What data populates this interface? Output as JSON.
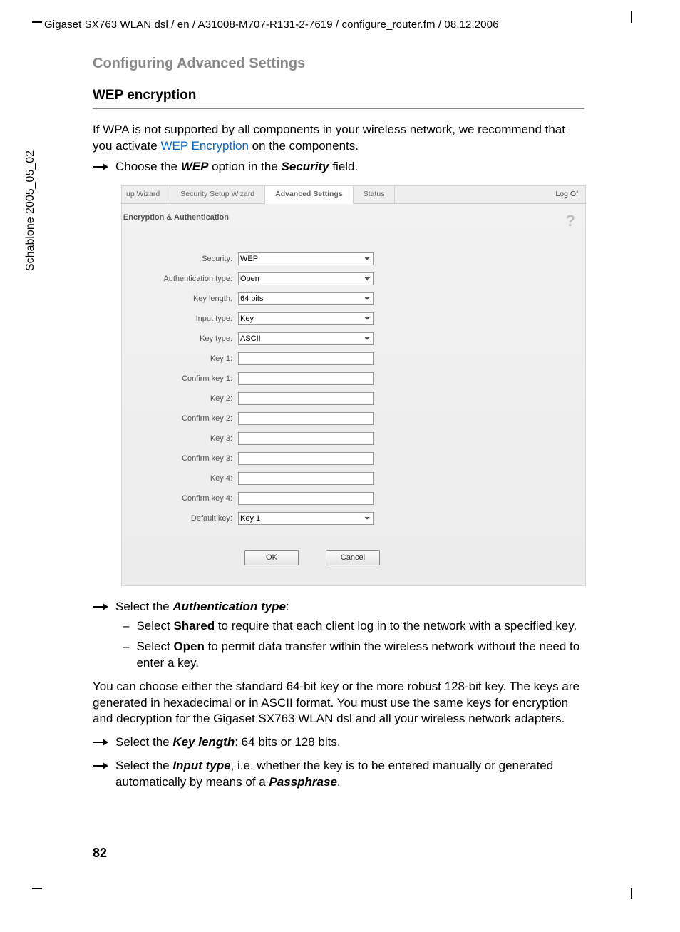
{
  "header_path": "Gigaset SX763 WLAN dsl / en / A31008-M707-R131-2-7619 / configure_router.fm / 08.12.2006",
  "side_label": "Schablone 2005_05_02",
  "breadcrumb": "Configuring Advanced Settings",
  "section_title": "WEP encryption",
  "intro_pre": "If WPA is not supported by all components in your wireless network, we recommend that you activate ",
  "intro_link": "WEP Encryption",
  "intro_post": " on the components.",
  "step1_pre": "Choose the ",
  "step1_b1": "WEP",
  "step1_mid": " option in the ",
  "step1_b2": "Security",
  "step1_post": " field.",
  "shot": {
    "tabs": {
      "t0": "up Wizard",
      "t1": "Security Setup Wizard",
      "t2": "Advanced Settings",
      "t3": "Status"
    },
    "logoff": "Log Of",
    "panel_title": "Encryption & Authentication",
    "help": "?",
    "labels": {
      "security": "Security:",
      "auth": "Authentication type:",
      "keylen": "Key length:",
      "inputtype": "Input type:",
      "keytype": "Key type:",
      "k1": "Key 1:",
      "ck1": "Confirm key 1:",
      "k2": "Key 2:",
      "ck2": "Confirm key 2:",
      "k3": "Key 3:",
      "ck3": "Confirm key 3:",
      "k4": "Key 4:",
      "ck4": "Confirm key 4:",
      "defkey": "Default key:"
    },
    "values": {
      "security": "WEP",
      "auth": "Open",
      "keylen": "64 bits",
      "inputtype": "Key",
      "keytype": "ASCII",
      "defkey": "Key 1"
    },
    "buttons": {
      "ok": "OK",
      "cancel": "Cancel"
    }
  },
  "step2_pre": "Select the ",
  "step2_b": "Authentication type",
  "step2_post": ":",
  "dash1_pre": "Select ",
  "dash1_b": "Shared",
  "dash1_post": " to require that each client log in to the network with a specified key.",
  "dash2_pre": "Select ",
  "dash2_b": "Open",
  "dash2_post": " to permit data transfer within the wireless network without the need to enter a key.",
  "para2": "You can choose either the standard 64-bit key or the more robust 128-bit key. The keys are generated in hexadecimal or in ASCII format. You must use the same keys for encryption and decryption for the Gigaset SX763 WLAN dsl and all your wireless network adapters.",
  "step3_pre": "Select the ",
  "step3_b": "Key length",
  "step3_post": ": 64 bits or 128 bits.",
  "step4_pre": "Select the ",
  "step4_b": "Input type",
  "step4_mid": ", i.e. whether the key is to be entered manually or generated automatically by means of a ",
  "step4_b2": "Passphrase",
  "step4_post": ".",
  "page_number": "82"
}
